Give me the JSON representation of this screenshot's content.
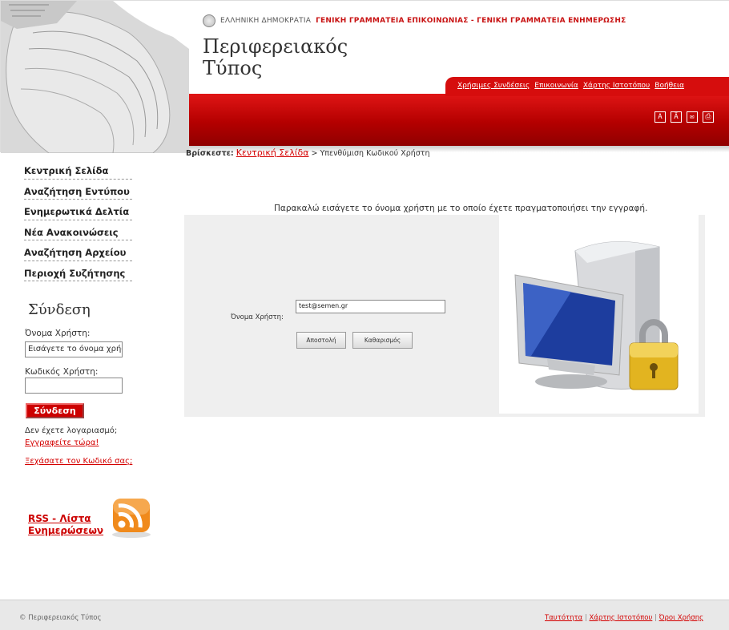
{
  "header": {
    "gov_prefix": "ΕΛΛΗΝΙΚΗ ΔΗΜΟΚΡΑΤΙΑ",
    "gov_secretariats": "ΓΕΝΙΚΗ ΓΡΑΜΜΑΤΕΙΑ ΕΠΙΚΟΙΝΩΝΙΑΣ - ΓΕΝΙΚΗ ΓΡΑΜΜΑΤΕΙΑ ΕΝΗΜΕΡΩΣΗΣ",
    "title_line1": "Περιφερειακός",
    "title_line2": "Τύπος",
    "top_links": [
      "Χρήσιμες Συνδέσεις",
      "Επικοινωνία",
      "Χάρτης Ιστοτόπου",
      "Βοήθεια"
    ],
    "tool_icons": [
      "text-size-icon",
      "accessibility-icon",
      "mail-icon",
      "print-icon"
    ]
  },
  "sidebar": {
    "nav": [
      "Κεντρική Σελίδα",
      "Αναζήτηση Εντύπου",
      "Ενημερωτικά Δελτία",
      "Νέα Ανακοινώσεις",
      "Αναζήτηση Αρχείου",
      "Περιοχή Συζήτησης"
    ],
    "login": {
      "title": "Σύνδεση",
      "username_label": "Όνομα Χρήστη:",
      "username_value": "Εισάγετε το όνομα χρήστη",
      "password_label": "Κωδικός Χρήστη:",
      "password_value": "",
      "button": "Σύνδεση",
      "no_account": "Δεν έχετε λογαριασμό;",
      "register": "Εγγραφείτε τώρα!",
      "forgot": "Ξεχάσατε τον Κωδικό σας;"
    },
    "rss": "RSS - Λίστα Ενημερώσεων"
  },
  "main": {
    "breadcrumb_label": "Βρίσκεστε:",
    "breadcrumb_home": "Κεντρική Σελίδα",
    "breadcrumb_sep": " > ",
    "breadcrumb_current": "Υπενθύμιση Κωδικού Χρήστη",
    "instruction": "Παρακαλώ εισάγετε το όνομα χρήστη με το οποίο έχετε πραγματοποιήσει την εγγραφή.",
    "username_label": "Όνομα Χρήστη:",
    "username_value": "test@semen.gr",
    "submit": "Αποστολή",
    "clear": "Καθαρισμός"
  },
  "footer": {
    "copyright": "© Περιφερειακός Τύπος",
    "links": [
      "Ταυτότητα",
      "Χάρτης Ιστοτόπου",
      "Όροι Χρήσης"
    ],
    "sep": " | "
  },
  "colors": {
    "brand_red": "#c80000",
    "panel_gray": "#efefef"
  }
}
